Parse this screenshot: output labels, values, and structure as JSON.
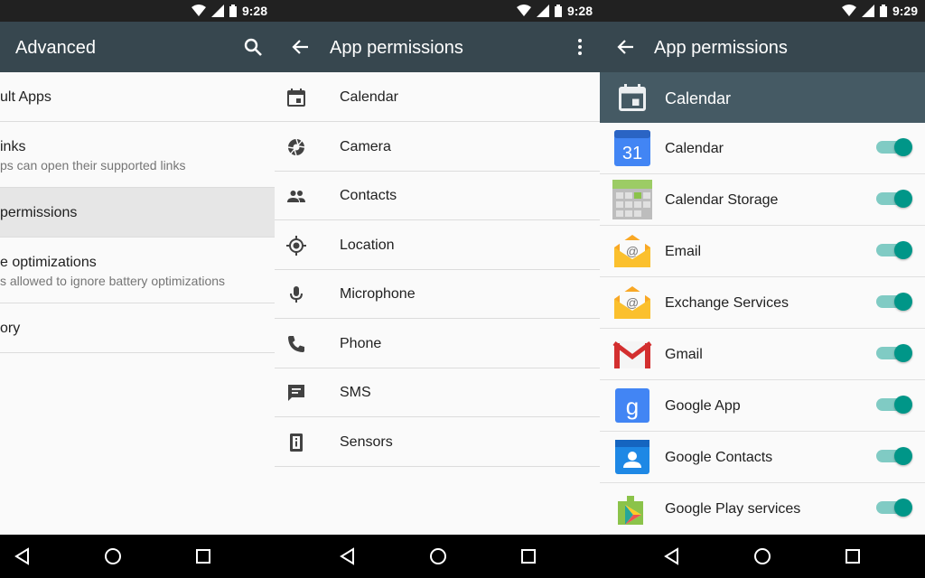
{
  "status": {
    "time_left": "9:28",
    "time_mid": "9:28",
    "time_right": "9:29"
  },
  "panel1": {
    "title": "Advanced",
    "icons": {
      "search": "search-icon"
    },
    "items": [
      {
        "title": "ult Apps",
        "subtitle": ""
      },
      {
        "title": "inks",
        "subtitle": "ps can open their supported links"
      },
      {
        "title": "permissions",
        "subtitle": ""
      },
      {
        "title": "e optimizations",
        "subtitle": "s allowed to ignore battery optimizations"
      },
      {
        "title": "ory",
        "subtitle": ""
      }
    ]
  },
  "panel2": {
    "title": "App permissions",
    "icons": {
      "back": "arrow-back-icon",
      "menu": "more-vert-icon"
    },
    "items": [
      {
        "label": "Calendar",
        "icon": "calendar-icon"
      },
      {
        "label": "Camera",
        "icon": "camera-icon"
      },
      {
        "label": "Contacts",
        "icon": "contacts-icon"
      },
      {
        "label": "Location",
        "icon": "location-icon"
      },
      {
        "label": "Microphone",
        "icon": "microphone-icon"
      },
      {
        "label": "Phone",
        "icon": "phone-icon"
      },
      {
        "label": "SMS",
        "icon": "sms-icon"
      },
      {
        "label": "Sensors",
        "icon": "sensors-icon"
      }
    ]
  },
  "panel3": {
    "title": "App permissions",
    "header": "Calendar",
    "apps": [
      {
        "label": "Calendar",
        "icon_text": "31",
        "enabled": true
      },
      {
        "label": "Calendar Storage",
        "enabled": true
      },
      {
        "label": "Email",
        "icon_text": "@",
        "enabled": true
      },
      {
        "label": "Exchange Services",
        "icon_text": "@",
        "enabled": true
      },
      {
        "label": "Gmail",
        "enabled": true
      },
      {
        "label": "Google App",
        "icon_text": "g",
        "enabled": true
      },
      {
        "label": "Google Contacts",
        "enabled": true
      },
      {
        "label": "Google Play services",
        "enabled": true
      }
    ]
  },
  "colors": {
    "appbar": "#37474f",
    "statusbar": "#212121",
    "toggle_on": "#009688",
    "toggle_track": "#80cbc4",
    "header": "#455a64"
  }
}
